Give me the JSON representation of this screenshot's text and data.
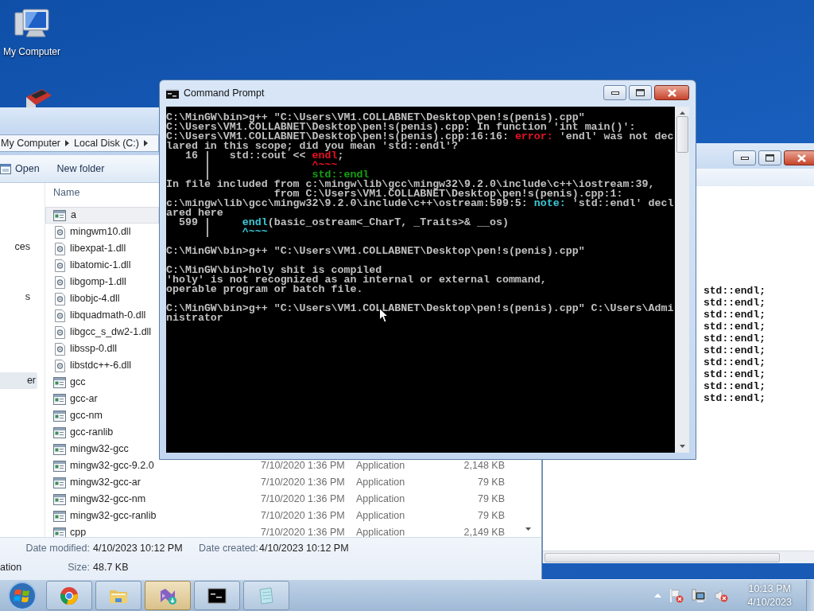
{
  "desktop_icons": [
    {
      "kind": "computer",
      "label": "My Computer"
    },
    {
      "kind": "device"
    }
  ],
  "explorer": {
    "breadcrumb": [
      "My Computer",
      "Local Disk (C:)"
    ],
    "toolbar": [
      "Open",
      "New folder"
    ],
    "nav_items": [
      {
        "label": "ces",
        "selected": false
      },
      {
        "label": "s",
        "selected": false
      },
      {
        "label": "er",
        "selected": true
      }
    ],
    "columns": [
      "Name"
    ],
    "files": [
      {
        "name": "a",
        "kind": "app",
        "selected": true
      },
      {
        "name": "mingwm10.dll",
        "kind": "dll",
        "selected": false
      },
      {
        "name": "libexpat-1.dll",
        "kind": "dll",
        "selected": false
      },
      {
        "name": "libatomic-1.dll",
        "kind": "dll",
        "selected": false
      },
      {
        "name": "libgomp-1.dll",
        "kind": "dll",
        "selected": false
      },
      {
        "name": "libobjc-4.dll",
        "kind": "dll",
        "selected": false
      },
      {
        "name": "libquadmath-0.dll",
        "kind": "dll",
        "selected": false
      },
      {
        "name": "libgcc_s_dw2-1.dll",
        "kind": "dll",
        "selected": false
      },
      {
        "name": "libssp-0.dll",
        "kind": "dll",
        "selected": false
      },
      {
        "name": "libstdc++-6.dll",
        "kind": "dll",
        "selected": false
      },
      {
        "name": "gcc",
        "kind": "app",
        "selected": false
      },
      {
        "name": "gcc-ar",
        "kind": "app",
        "selected": false
      },
      {
        "name": "gcc-nm",
        "kind": "app",
        "selected": false
      },
      {
        "name": "gcc-ranlib",
        "kind": "app",
        "selected": false
      },
      {
        "name": "mingw32-gcc",
        "kind": "app",
        "selected": false
      },
      {
        "name": "mingw32-gcc-9.2.0",
        "kind": "app",
        "selected": false,
        "date": "7/10/2020 1:36 PM",
        "type": "Application",
        "size": "2,148 KB"
      },
      {
        "name": "mingw32-gcc-ar",
        "kind": "app",
        "selected": false,
        "date": "7/10/2020 1:36 PM",
        "type": "Application",
        "size": "79 KB"
      },
      {
        "name": "mingw32-gcc-nm",
        "kind": "app",
        "selected": false,
        "date": "7/10/2020 1:36 PM",
        "type": "Application",
        "size": "79 KB"
      },
      {
        "name": "mingw32-gcc-ranlib",
        "kind": "app",
        "selected": false,
        "date": "7/10/2020 1:36 PM",
        "type": "Application",
        "size": "79 KB"
      },
      {
        "name": "cpp",
        "kind": "app",
        "selected": false,
        "date": "7/10/2020 1:36 PM",
        "type": "Application",
        "size": "2,149 KB"
      }
    ],
    "details": {
      "file_type": "ation",
      "fields": [
        {
          "label": "Date modified:",
          "value": "4/10/2023 10:12 PM"
        },
        {
          "label": "Date created:",
          "value": "4/10/2023 10:12 PM"
        },
        {
          "label": "Size:",
          "value": "48.7 KB"
        }
      ]
    }
  },
  "editor": {
    "lines": [
      "std::endl;",
      "std::endl;",
      "std::endl;",
      "std::endl;",
      "std::endl;",
      "std::endl;",
      "std::endl;",
      "std::endl;",
      "std::endl;",
      "std::endl;"
    ]
  },
  "console": {
    "title": "Command Prompt",
    "lines": [
      {
        "segments": [
          {
            "text": "C:\\MinGW\\bin>g++ \"C:\\Users\\VM1.COLLABNET\\Desktop\\pen!s(penis).cpp\"",
            "kind": "plain"
          }
        ]
      },
      {
        "segments": [
          {
            "text": "C:\\Users\\VM1.COLLABNET\\Desktop\\pen!s(penis).cpp: In function 'int main()':",
            "kind": "plain"
          }
        ]
      },
      {
        "segments": [
          {
            "text": "C:\\Users\\VM1.COLLABNET\\Desktop\\pen!s(penis).cpp:16:16: ",
            "kind": "plain"
          },
          {
            "text": "error:",
            "kind": "error"
          },
          {
            "text": " 'endl' was not dec",
            "kind": "plain"
          }
        ]
      },
      {
        "segments": [
          {
            "text": "lared in this scope; did you mean 'std::endl'?",
            "kind": "plain"
          }
        ]
      },
      {
        "segments": [
          {
            "text": "   16 |   std::cout << ",
            "kind": "plain"
          },
          {
            "text": "endl",
            "kind": "error"
          },
          {
            "text": ";",
            "kind": "plain"
          }
        ]
      },
      {
        "segments": [
          {
            "text": "      |                ",
            "kind": "plain"
          },
          {
            "text": "^~~~",
            "kind": "error"
          }
        ]
      },
      {
        "segments": [
          {
            "text": "      |                ",
            "kind": "plain"
          },
          {
            "text": "std::endl",
            "kind": "fix"
          }
        ]
      },
      {
        "segments": [
          {
            "text": "In file included from c:\\mingw\\lib\\gcc\\mingw32\\9.2.0\\include\\c++\\iostream:39,",
            "kind": "plain"
          }
        ]
      },
      {
        "segments": [
          {
            "text": "                 from C:\\Users\\VM1.COLLABNET\\Desktop\\pen!s(penis).cpp:1:",
            "kind": "plain"
          }
        ]
      },
      {
        "segments": [
          {
            "text": "c:\\mingw\\lib\\gcc\\mingw32\\9.2.0\\include\\c++\\ostream:599:5: ",
            "kind": "plain"
          },
          {
            "text": "note:",
            "kind": "note"
          },
          {
            "text": " 'std::endl' decl",
            "kind": "plain"
          }
        ]
      },
      {
        "segments": [
          {
            "text": "ared here",
            "kind": "plain"
          }
        ]
      },
      {
        "segments": [
          {
            "text": "  599 |     ",
            "kind": "plain"
          },
          {
            "text": "endl",
            "kind": "note"
          },
          {
            "text": "(basic_ostream<_CharT, _Traits>& __os)",
            "kind": "plain"
          }
        ]
      },
      {
        "segments": [
          {
            "text": "      |     ",
            "kind": "plain"
          },
          {
            "text": "^~~~",
            "kind": "note"
          }
        ]
      },
      {
        "gap_before": true,
        "segments": [
          {
            "text": "C:\\MinGW\\bin>g++ \"C:\\Users\\VM1.COLLABNET\\Desktop\\pen!s(penis).cpp\"",
            "kind": "plain"
          }
        ]
      },
      {
        "gap_before": true,
        "segments": [
          {
            "text": "C:\\MinGW\\bin>holy shit is compiled",
            "kind": "plain"
          }
        ]
      },
      {
        "segments": [
          {
            "text": "'holy' is not recognized as an internal or external command,",
            "kind": "plain"
          }
        ]
      },
      {
        "segments": [
          {
            "text": "operable program or batch file.",
            "kind": "plain"
          }
        ]
      },
      {
        "gap_before": true,
        "segments": [
          {
            "text": "C:\\MinGW\\bin>g++ \"C:\\Users\\VM1.COLLABNET\\Desktop\\pen!s(penis).cpp\" C:\\Users\\Admi",
            "kind": "plain"
          }
        ]
      },
      {
        "segments": [
          {
            "text": "nistrator",
            "kind": "plain"
          }
        ]
      }
    ]
  },
  "taskbar": {
    "apps": [
      {
        "kind": "browser",
        "selected": false
      },
      {
        "kind": "folder",
        "selected": false
      },
      {
        "kind": "installer",
        "selected": true
      },
      {
        "kind": "terminal",
        "selected": false
      },
      {
        "kind": "notepad",
        "selected": false
      }
    ],
    "clock": {
      "time": "10:13 PM",
      "date": "4/10/2023"
    }
  }
}
